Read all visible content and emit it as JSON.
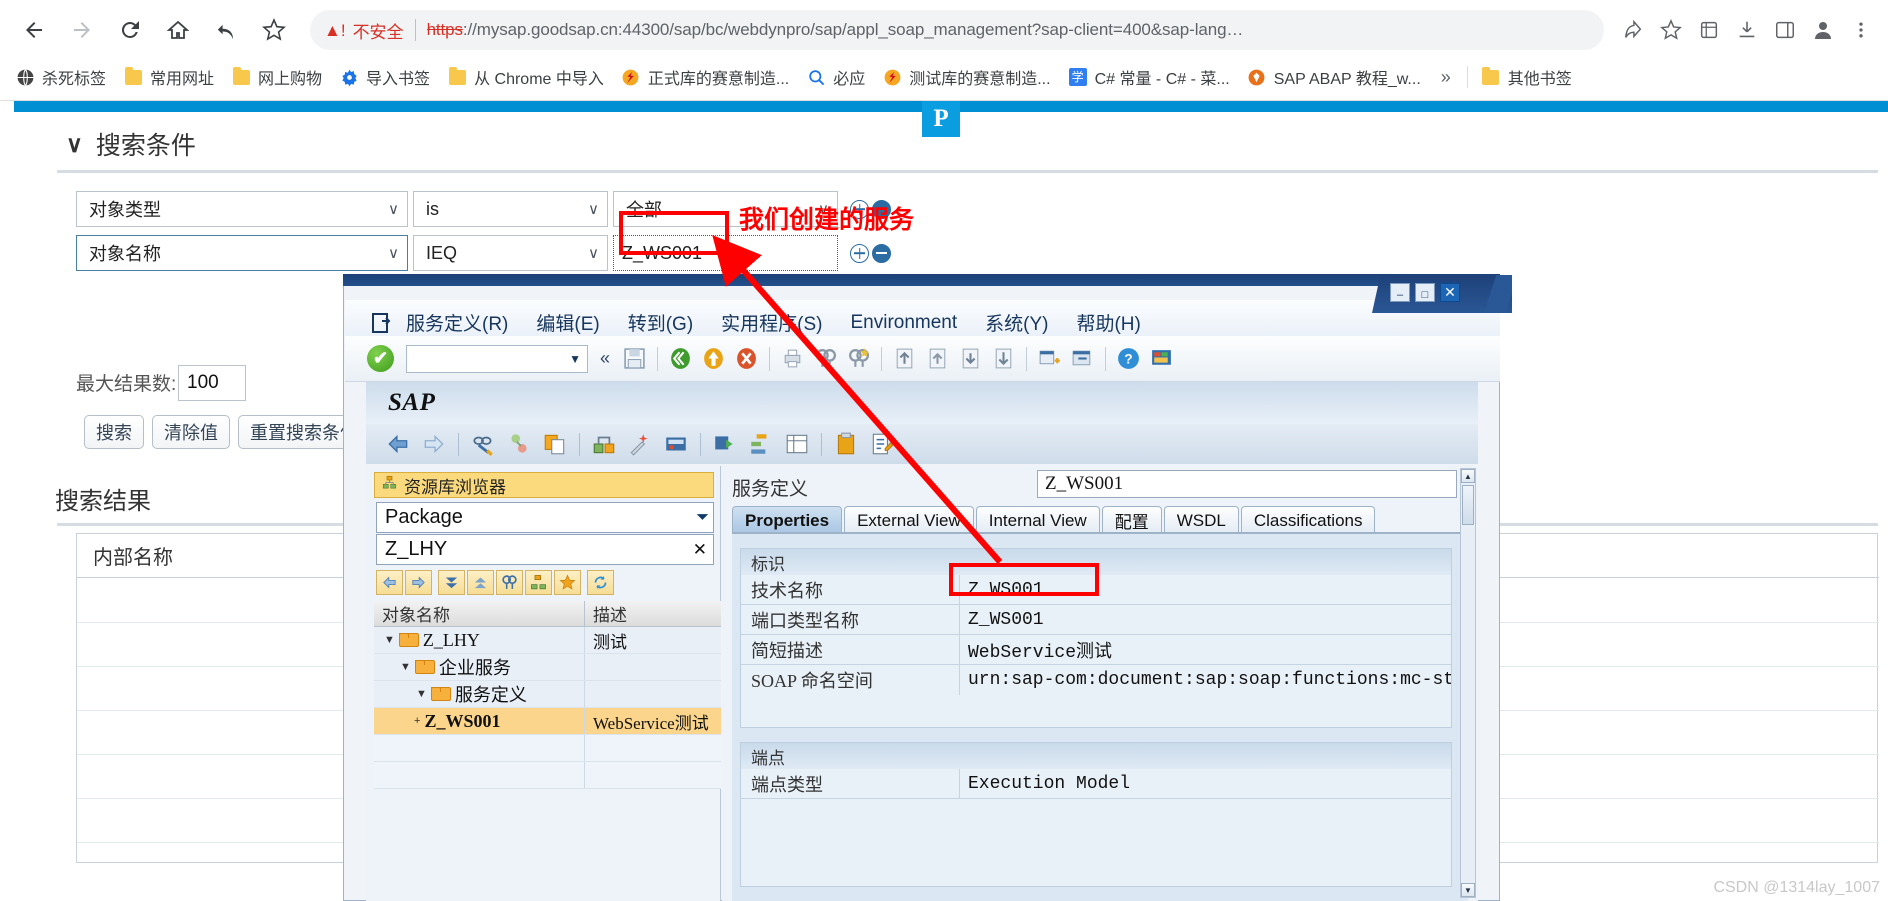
{
  "browser": {
    "nav": {
      "back": "back-arrow",
      "forward": "forward-arrow",
      "reload": "reload",
      "home": "home",
      "undo": "undo",
      "bookmark": "star"
    },
    "omnibox": {
      "warning_icon": "warning-triangle",
      "not_secure_label": "不安全",
      "url_scheme": "https",
      "url_rest": "://mysap.goodsap.cn:44300/sap/bc/webdynpro/sap/appl_soap_management?sap-client=400&sap-lang…",
      "url_full": "https://mysap.goodsap.cn:44300/sap/bc/webdynpro/sap/appl_soap_management?sap-client=400&sap-lang…"
    },
    "toolbar_right": [
      "share-icon",
      "star-icon",
      "extensions-icon",
      "download-icon",
      "sidepanel-icon",
      "profile-icon",
      "menu-icon"
    ],
    "bookmarks": [
      {
        "label": "杀死标签",
        "icon": "globe-icon"
      },
      {
        "label": "常用网址",
        "icon": "folder-icon"
      },
      {
        "label": "网上购物",
        "icon": "folder-icon"
      },
      {
        "label": "导入书签",
        "icon": "gear-icon"
      },
      {
        "label": "从 Chrome 中导入",
        "icon": "folder-icon"
      },
      {
        "label": "正式库的赛意制造...",
        "icon": "sap-icon"
      },
      {
        "label": "必应",
        "icon": "search-icon"
      },
      {
        "label": "测试库的赛意制造...",
        "icon": "sap-icon"
      },
      {
        "label": "C# 常量 - C# - 菜...",
        "icon": "study-icon"
      },
      {
        "label": "SAP ABAP 教程_w...",
        "icon": "abap-icon"
      }
    ],
    "bookmarks_overflow": "»",
    "other_bookmarks": {
      "label": "其他书签",
      "icon": "folder-icon"
    }
  },
  "webdynpro": {
    "section_title": "搜索条件",
    "collapse_icon": "chevron-down-icon",
    "pdf_badge": "P",
    "criteria": [
      {
        "field": "对象类型",
        "operator": "is",
        "value": "全部",
        "value_is_dropdown": true
      },
      {
        "field": "对象名称",
        "operator": "IEQ",
        "value": "Z_WS001",
        "value_is_dropdown": false
      }
    ],
    "max_results_label": "最大结果数:",
    "max_results_value": "100",
    "buttons": {
      "search": "搜索",
      "clear": "清除值",
      "reset": "重置搜索条件"
    },
    "results_title": "搜索结果",
    "results_column": "内部名称"
  },
  "annotation": {
    "text": "我们创建的服务",
    "color": "#ff0000"
  },
  "sapgui": {
    "window_buttons": {
      "minimize": "–",
      "maximize": "□",
      "close": "✕"
    },
    "menu": [
      {
        "label": "服务定义(R)",
        "accel": "R"
      },
      {
        "label": "编辑(E)",
        "accel": "E"
      },
      {
        "label": "转到(G)",
        "accel": "G"
      },
      {
        "label": "实用程序(S)",
        "accel": "S"
      },
      {
        "label": "Environment",
        "accel": "E"
      },
      {
        "label": "系统(Y)",
        "accel": "Y"
      },
      {
        "label": "帮助(H)",
        "accel": "H"
      }
    ],
    "command_field_value": "",
    "toolbar_icons": [
      "enter-icon",
      "save-icon",
      "back-icon",
      "exit-icon",
      "cancel-icon",
      "print-icon",
      "find-icon",
      "find-next-icon",
      "first-page-icon",
      "previous-page-icon",
      "next-page-icon",
      "last-page-icon",
      "create-session-icon",
      "create-shortcut-icon",
      "help-icon",
      "layout-icon"
    ],
    "logo": "SAP",
    "app_toolbar_icons": [
      "back-arrow-icon",
      "forward-arrow-icon",
      "display-change-icon",
      "where-used-icon",
      "copy-icon",
      "other-object-icon",
      "wizard-icon",
      "test-icon",
      "activate-icon",
      "hierarchy-icon",
      "list-icon",
      "table-icon",
      "clipboard-icon",
      "note-icon"
    ],
    "repository_browser": {
      "title": "资源库浏览器",
      "icon": "hierarchy-icon",
      "type_select": "Package",
      "type_caret": "chevron-down-icon",
      "package_value": "Z_LHY",
      "clear_icon": "x-icon",
      "toolbar_icons": [
        "back-icon",
        "forward-icon",
        "expand-all-icon",
        "collapse-all-icon",
        "find-icon",
        "hierarchy-icon",
        "favorites-icon",
        "refresh-icon"
      ],
      "columns": [
        "对象名称",
        "描述"
      ],
      "tree": [
        {
          "name": "Z_LHY",
          "desc": "测试",
          "depth": 0,
          "type": "folder",
          "expanded": true,
          "selected": false
        },
        {
          "name": "企业服务",
          "desc": "",
          "depth": 1,
          "type": "folder",
          "expanded": true,
          "selected": false
        },
        {
          "name": "服务定义",
          "desc": "",
          "depth": 2,
          "type": "folder",
          "expanded": true,
          "selected": false
        },
        {
          "name": "Z_WS001",
          "desc": "WebService测试",
          "depth": 3,
          "type": "leaf",
          "expanded": false,
          "selected": true
        }
      ]
    },
    "detail": {
      "definition_label": "服务定义",
      "definition_value": "Z_WS001",
      "tabs": [
        {
          "label": "Properties",
          "active": true
        },
        {
          "label": "External View",
          "active": false
        },
        {
          "label": "Internal View",
          "active": false
        },
        {
          "label": "配置",
          "active": false
        },
        {
          "label": "WSDL",
          "active": false
        },
        {
          "label": "Classifications",
          "active": false
        }
      ],
      "group_identification": {
        "title": "标识",
        "rows": [
          {
            "label": "技术名称",
            "value": "Z_WS001",
            "highlight": true
          },
          {
            "label": "端口类型名称",
            "value": "Z_WS001",
            "highlight": false
          },
          {
            "label": "简短描述",
            "value": "WebService测试",
            "highlight": false
          },
          {
            "label": "SOAP 命名空间",
            "value": "urn:sap-com:document:sap:soap:functions:mc-style",
            "highlight": false,
            "bold_prefix": "SOAP"
          }
        ]
      },
      "group_endpoint": {
        "title": "端点",
        "rows": [
          {
            "label": "端点类型",
            "value": "Execution Model"
          }
        ]
      }
    }
  },
  "watermark": "CSDN @1314lay_1007"
}
